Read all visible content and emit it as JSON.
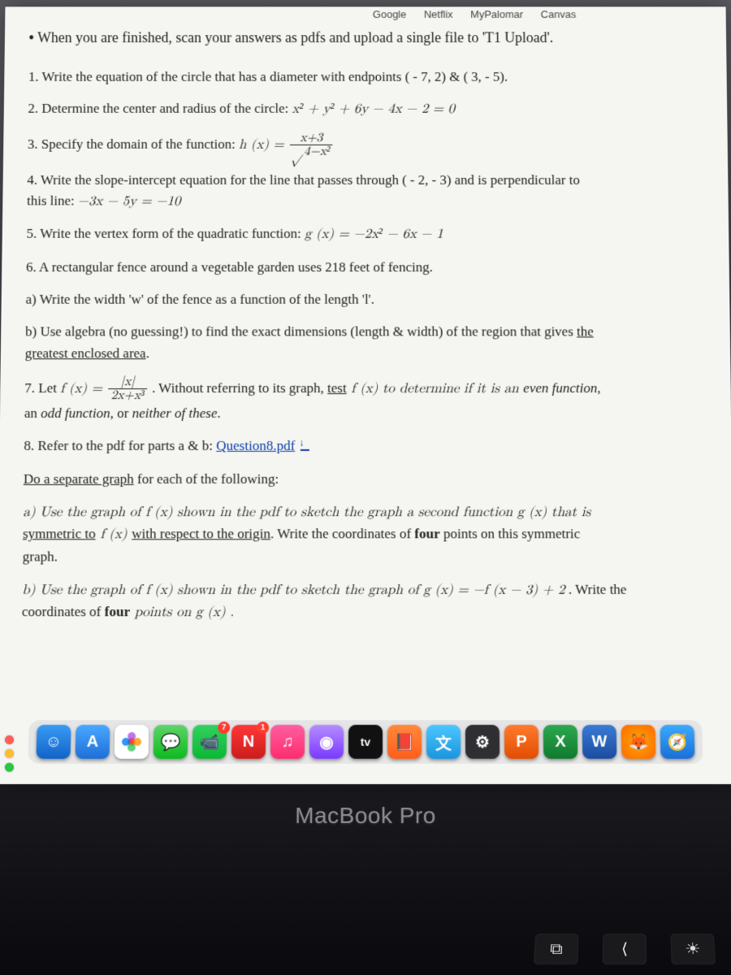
{
  "bookmarks": [
    "Google",
    "Netflix",
    "MyPalomar",
    "Canvas"
  ],
  "bullet": "When you are finished, scan your answers as pdfs and upload a single file to 'T1 Upload'.",
  "q1": {
    "prefix": "1.  Write the equation of the circle that has a diameter with endpoints ",
    "pts": "( - 7, 2) & ( 3, - 5)."
  },
  "q2": {
    "prefix": "2.  Determine the center and radius of the circle:  ",
    "eq": "x² + y² + 6y − 4x − 2 = 0"
  },
  "q3": {
    "prefix": "3.  Specify the domain of the function:  ",
    "fn": "h (x) = ",
    "num": "x+3",
    "den_rad": "4−x²"
  },
  "q4": {
    "line1": "4.  Write the slope-intercept equation for the line that passes through ( - 2, - 3) and is perpendicular to",
    "line2_pre": "this line:   ",
    "line2_eq": "−3x − 5y = −10"
  },
  "q5": {
    "prefix": "5.  Write the vertex form of the quadratic function:  ",
    "eq": "g (x) = −2x² − 6x − 1"
  },
  "q6": {
    "main": "6.  A rectangular fence around a vegetable garden uses 218 feet of fencing.",
    "a": "a)  Write the width 'w' of the fence as a function of the length 'l'.",
    "b_pre": "b)  Use algebra (no guessing!) to find the exact dimensions (length & width) of the region that gives ",
    "b_u1": "the",
    "b_u2": "greatest enclosed area",
    "b_dot": "."
  },
  "q7": {
    "pre": "7.  Let ",
    "fn": "f (x) = ",
    "num": "|x|",
    "den": "2x+x³",
    "mid1": " .   Without referring to its graph, ",
    "test": "test",
    "mid2": " f (x) to determine if it is an ",
    "even": "even function",
    "mid3": ",",
    "line2_pre": "an ",
    "odd": "odd function",
    "line2_mid": ", or ",
    "neither": "neither of these",
    "line2_end": "."
  },
  "q8": {
    "pre": "8.  Refer to the pdf for parts a & b:  ",
    "link": "Question8.pdf",
    "sep_u": "Do a separate graph",
    "sep_after": " for each of the following:",
    "a1": "a)  Use the graph of  f (x)  shown in the pdf to sketch the graph a second function g (x)  that is",
    "a2_u1": "symmetric to",
    "a2_mid1": "  f (x)  ",
    "a2_u2": "with respect to the origin",
    "a2_end": ".  Write the coordinates of ",
    "a2_four": "four",
    "a2_end2": " points on this symmetric",
    "a3": "graph.",
    "b1_pre": "b)  Use the graph of  f (x)  shown in the pdf to sketch the graph of  ",
    "b1_eq": "g (x) = −f (x − 3) + 2",
    "b1_end": " .  Write the",
    "b2_pre": "coordinates of ",
    "b2_four": "four",
    "b2_end": " points on  g (x) ."
  },
  "dock": {
    "badges": {
      "facetime": "7",
      "messages": "1"
    }
  },
  "hinge": "MacBook Pro",
  "tv": "tv"
}
